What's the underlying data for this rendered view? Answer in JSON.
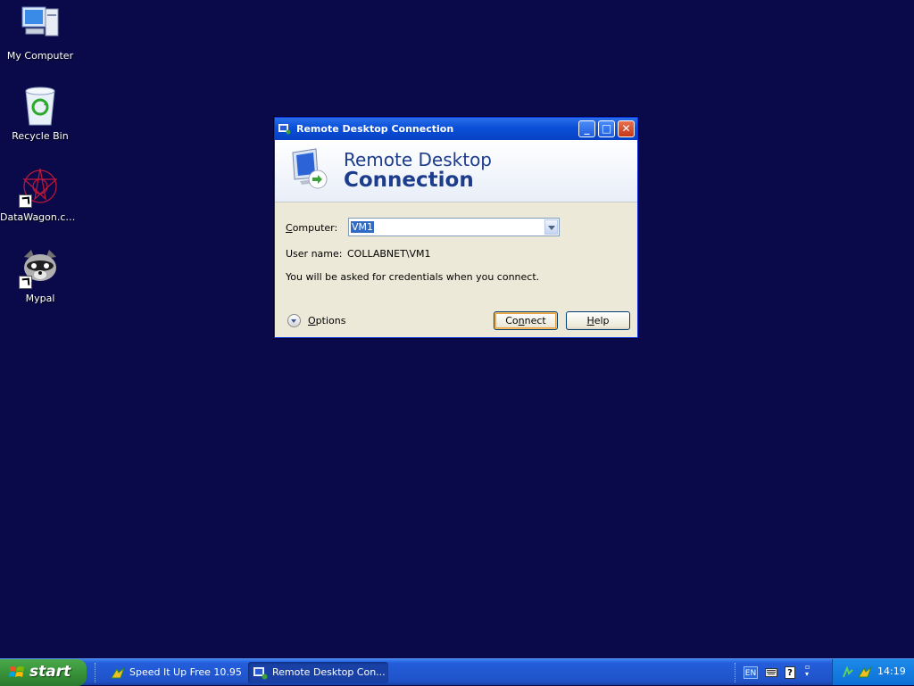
{
  "desktop": {
    "icons": [
      {
        "label": "My Computer"
      },
      {
        "label": "Recycle Bin"
      },
      {
        "label": "DataWagon.co..."
      },
      {
        "label": "Mypal"
      }
    ]
  },
  "window": {
    "title": "Remote Desktop Connection",
    "banner_line1": "Remote Desktop",
    "banner_line2": "Connection",
    "computer_label_u": "C",
    "computer_label_rest": "omputer:",
    "computer_value": "VM1",
    "username_label": "User name:",
    "username_value": "COLLABNET\\VM1",
    "info_text": "You will be asked for credentials when you connect.",
    "options_label_u": "O",
    "options_label_rest": "ptions",
    "connect_label_pre": "Co",
    "connect_label_u": "n",
    "connect_label_rest": "nect",
    "help_label_u": "H",
    "help_label_rest": "elp"
  },
  "taskbar": {
    "start_label": "start",
    "tasks": [
      {
        "label": "Speed It Up Free 10.95"
      },
      {
        "label": "Remote Desktop Con..."
      }
    ],
    "lang": "EN",
    "clock": "14:19"
  },
  "colors": {
    "desktop_bg": "#0a0a4a",
    "titlebar": "#0a4fd8",
    "taskbar": "#245edb",
    "start": "#38943a"
  }
}
